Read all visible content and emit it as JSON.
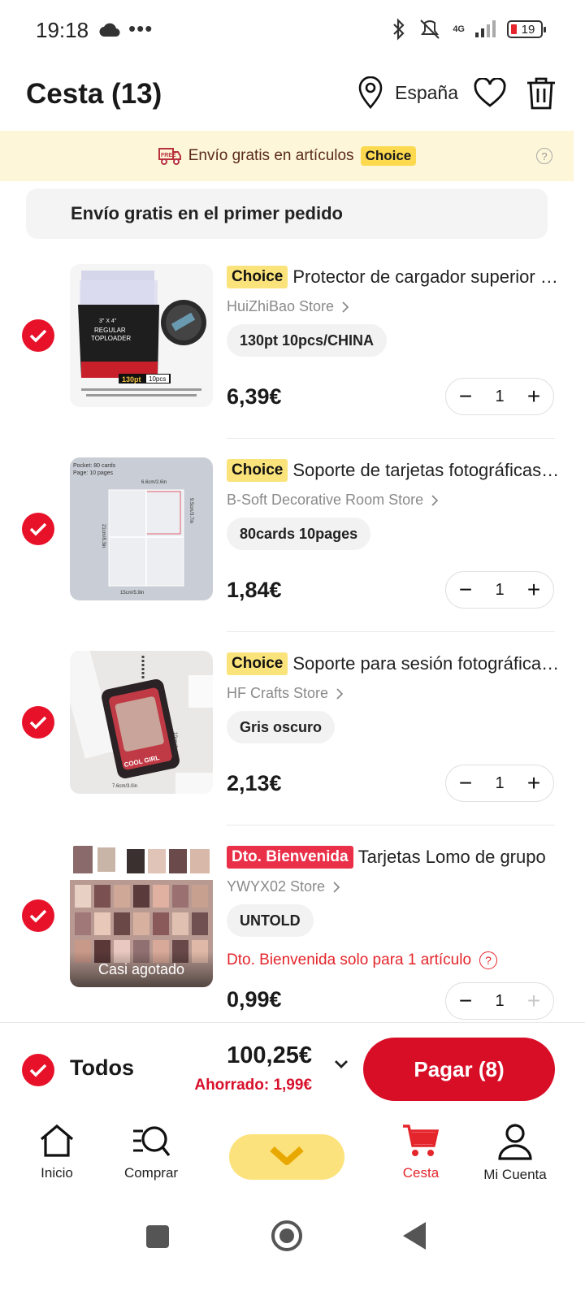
{
  "status_bar": {
    "time": "19:18",
    "more": "•••",
    "network": "4G",
    "battery": "19"
  },
  "header": {
    "title": "Cesta (13)",
    "location": "España",
    "icons": [
      "location-pin-icon",
      "heart-icon",
      "trash-icon"
    ]
  },
  "banner": {
    "text": "Envío gratis en artículos",
    "tag": "Choice",
    "free_badge": "FREE"
  },
  "first_order": {
    "text": "Envío gratis en el primer pedido"
  },
  "items": [
    {
      "tag": "Choice",
      "name": "Protector de cargador superior para tarjetas",
      "store": "HuiZhiBao Store",
      "variant": "130pt  10pcs/CHINA",
      "price": "6,39€",
      "qty": "1",
      "selected": true,
      "thumb_text": [
        "3\" X 4\"",
        "REGULAR",
        "TOPLOADER",
        "130pt",
        "10pcs"
      ]
    },
    {
      "tag": "Choice",
      "name": "Soporte de tarjetas fotográficas para álbum",
      "store": "B-Soft Decorative Room Store",
      "variant": "80cards  10pages",
      "price": "1,84€",
      "qty": "1",
      "selected": true,
      "thumb_text": [
        "Pocket:  80 cards",
        "Page:  10 pages",
        "6.6cm/2.6in",
        "9.5cm/3.7in",
        "21cm/8.3in",
        "15cm/5.9in"
      ]
    },
    {
      "tag": "Choice",
      "name": "Soporte para sesión fotográfica de tarjetas",
      "store": "HF Crafts Store",
      "variant": "Gris oscuro",
      "price": "2,13€",
      "qty": "1",
      "selected": true,
      "thumb_text": [
        "COOL GIRL",
        "7.6cm/3.0in",
        "10cm/3.9in"
      ]
    },
    {
      "tag": "Dto. Bienvenida",
      "name": "Tarjetas Lomo de grupo",
      "store": "YWYX02 Store",
      "variant": "UNTOLD",
      "warning": "Dto. Bienvenida solo para 1 artículo",
      "price": "0,99€",
      "qty": "1",
      "selected": true,
      "overlay": "Casi agotado"
    }
  ],
  "checkout": {
    "all_label": "Todos",
    "total": "100,25€",
    "saved": "Ahorrado: 1,99€",
    "pay_label": "Pagar (8)"
  },
  "tabbar": {
    "tabs": [
      {
        "label": "Inicio",
        "icon": "home-icon"
      },
      {
        "label": "Comprar",
        "icon": "search-list-icon"
      },
      {
        "label": "Cesta",
        "icon": "cart-icon",
        "active": true
      },
      {
        "label": "Mi Cuenta",
        "icon": "account-icon"
      }
    ]
  },
  "colors": {
    "accent": "#e8112a",
    "choice": "#fbe37b",
    "banner_bg": "#fdf6d8",
    "pay_button": "#d80e27"
  }
}
